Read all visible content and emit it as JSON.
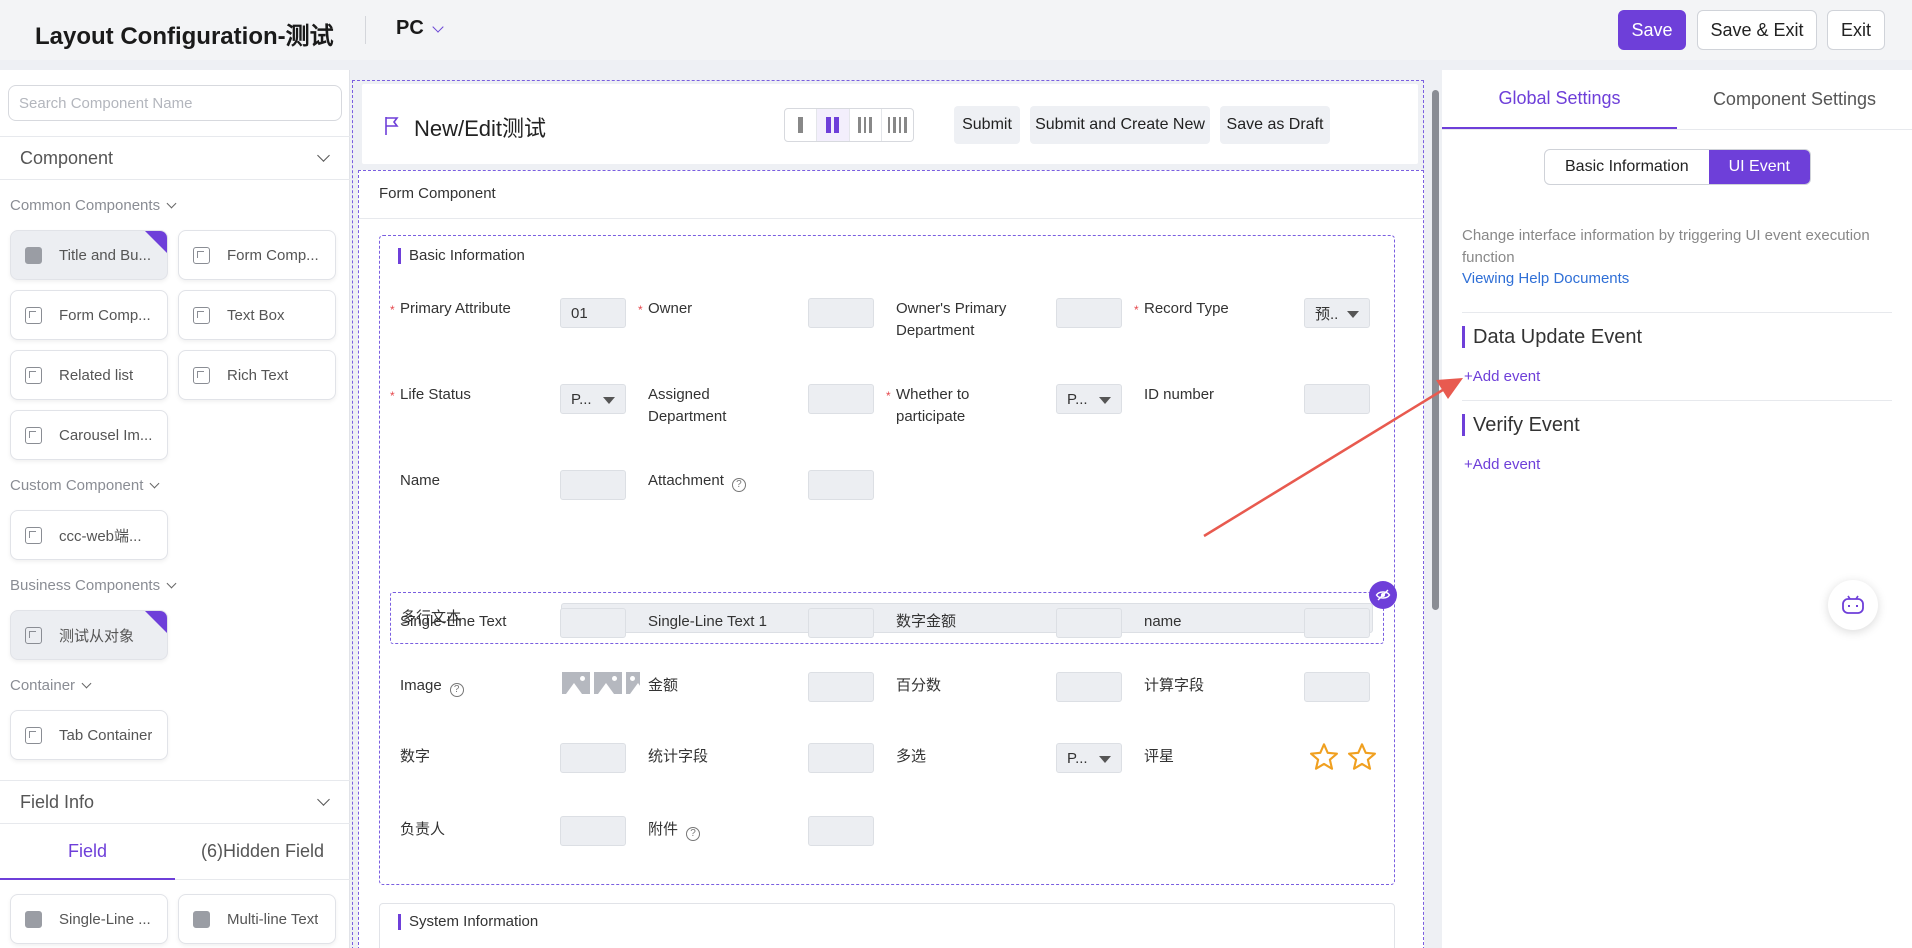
{
  "header": {
    "title": "Layout Configuration-测试",
    "device": "PC",
    "save": "Save",
    "save_exit": "Save & Exit",
    "exit": "Exit"
  },
  "left": {
    "search_placeholder": "Search Component Name",
    "component_section": "Component",
    "groups": {
      "common": "Common Components",
      "custom": "Custom Component",
      "business": "Business Components",
      "container": "Container"
    },
    "common_items": [
      "Title and Bu...",
      "Form Comp...",
      "Form Comp...",
      "Text Box",
      "Related list",
      "Rich Text",
      "Carousel Im..."
    ],
    "custom_items": [
      "ccc-web端..."
    ],
    "business_items": [
      "测试从对象"
    ],
    "container_items": [
      "Tab Container"
    ],
    "field_section": "Field Info",
    "tabs": [
      "Field",
      "(6)Hidden Field"
    ],
    "field_items": [
      "Single-Line ...",
      "Multi-line Text"
    ]
  },
  "canvas": {
    "page_title": "New/Edit测试",
    "buttons": [
      "Submit",
      "Submit and Create New",
      "Save as Draft"
    ],
    "form_component": "Form Component",
    "basic_info": "Basic Information",
    "system_info": "System Information",
    "fields": {
      "primary_attribute": "Primary Attribute",
      "primary_attribute_value": "01",
      "owner": "Owner",
      "owners_dept": "Owner's Primary Department",
      "record_type": "Record Type",
      "record_type_value": "预..",
      "life_status": "Life Status",
      "life_status_value": "P...",
      "assigned_dept": "Assigned Department",
      "whether_participate": "Whether to participate",
      "whether_participate_value": "P...",
      "id_number": "ID number",
      "name": "Name",
      "attachment": "Attachment",
      "multiline": "多行文本",
      "single_line": "Single-Line Text",
      "single_line_1": "Single-Line Text 1",
      "amount_cn": "数字金额",
      "name_lower": "name",
      "image": "Image",
      "jine": "金额",
      "percent": "百分数",
      "calc": "计算字段",
      "number": "数字",
      "stat": "统计字段",
      "multiselect": "多选",
      "multiselect_value": "P...",
      "rating": "评星",
      "owner_cn": "负责人",
      "attachment_cn": "附件"
    }
  },
  "right": {
    "tabs": [
      "Global Settings",
      "Component Settings"
    ],
    "seg": [
      "Basic Information",
      "UI Event"
    ],
    "description": "Change interface information by triggering UI event execution function",
    "help_link": "Viewing Help Documents",
    "data_update": "Data Update Event",
    "verify": "Verify Event",
    "add_event": "+Add event"
  },
  "colors": {
    "accent": "#6e3fd9",
    "link": "#2f6fd6",
    "arrow": "#e85a4f",
    "required": "#e5484d",
    "star": "#f0a020"
  }
}
